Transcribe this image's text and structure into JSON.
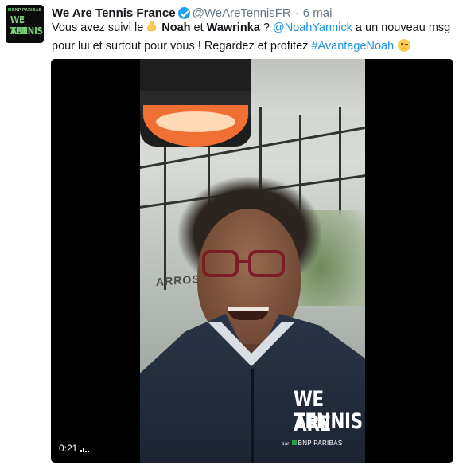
{
  "tweet": {
    "avatar": {
      "sub_label": "BNP PARIBAS",
      "line1": "WE ARE",
      "line2": "TENNIS"
    },
    "display_name": "We Are Tennis France",
    "handle": "@WeAreTennisFR",
    "separator": "·",
    "date": "6 mai",
    "text": {
      "part1": "Vous avez suivi le",
      "name1": "Noah",
      "part2": "et",
      "name2": "Wawrinka",
      "part3": "?",
      "mention": "@NoahYannick",
      "part4": "a un nouveau msg pour lui et surtout pour vous ! Regardez et profitez",
      "hashtag": "#AvantageNoah"
    },
    "media": {
      "time": "0:21",
      "watermark_line1": "WE ARE",
      "watermark_line2": "TENNIS",
      "watermark_par": "par",
      "watermark_sponsor": "BNP PARIBAS",
      "background_sign": "ARROS"
    }
  },
  "colors": {
    "link": "#1b95e0",
    "verified": "#1da1f2",
    "secondary_text": "#657786",
    "brand_green": "#7ccf78",
    "lamp_orange": "#f07034"
  },
  "icons": [
    "verified-badge-icon",
    "flexed-biceps-emoji",
    "winking-face-emoji",
    "volume-icon"
  ]
}
